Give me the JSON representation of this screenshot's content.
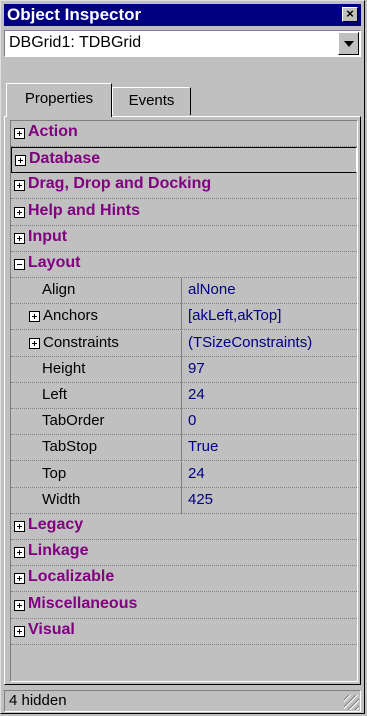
{
  "window": {
    "title": "Object Inspector"
  },
  "selector": {
    "value": "DBGrid1: TDBGrid"
  },
  "tabs": [
    {
      "label": "Properties",
      "active": true
    },
    {
      "label": "Events",
      "active": false
    }
  ],
  "rows": [
    {
      "kind": "category",
      "label": "Action",
      "expanded": false
    },
    {
      "kind": "category",
      "label": "Database",
      "expanded": false,
      "selected": true
    },
    {
      "kind": "category",
      "label": "Drag, Drop and Docking",
      "expanded": false
    },
    {
      "kind": "category",
      "label": "Help and Hints",
      "expanded": false
    },
    {
      "kind": "category",
      "label": "Input",
      "expanded": false
    },
    {
      "kind": "category",
      "label": "Layout",
      "expanded": true
    },
    {
      "kind": "property",
      "name": "Align",
      "value": "alNone",
      "expandable": false
    },
    {
      "kind": "property",
      "name": "Anchors",
      "value": "[akLeft,akTop]",
      "expandable": true
    },
    {
      "kind": "property",
      "name": "Constraints",
      "value": "(TSizeConstraints)",
      "expandable": true
    },
    {
      "kind": "property",
      "name": "Height",
      "value": "97",
      "expandable": false
    },
    {
      "kind": "property",
      "name": "Left",
      "value": "24",
      "expandable": false
    },
    {
      "kind": "property",
      "name": "TabOrder",
      "value": "0",
      "expandable": false
    },
    {
      "kind": "property",
      "name": "TabStop",
      "value": "True",
      "expandable": false
    },
    {
      "kind": "property",
      "name": "Top",
      "value": "24",
      "expandable": false
    },
    {
      "kind": "property",
      "name": "Width",
      "value": "425",
      "expandable": false
    },
    {
      "kind": "category",
      "label": "Legacy",
      "expanded": false
    },
    {
      "kind": "category",
      "label": "Linkage",
      "expanded": false
    },
    {
      "kind": "category",
      "label": "Localizable",
      "expanded": false
    },
    {
      "kind": "category",
      "label": "Miscellaneous",
      "expanded": false
    },
    {
      "kind": "category",
      "label": "Visual",
      "expanded": false
    }
  ],
  "status": {
    "text": "4 hidden"
  },
  "colors": {
    "titlebar": "#000080",
    "category": "#800080",
    "value": "#000080",
    "face": "#c0c0c0"
  }
}
